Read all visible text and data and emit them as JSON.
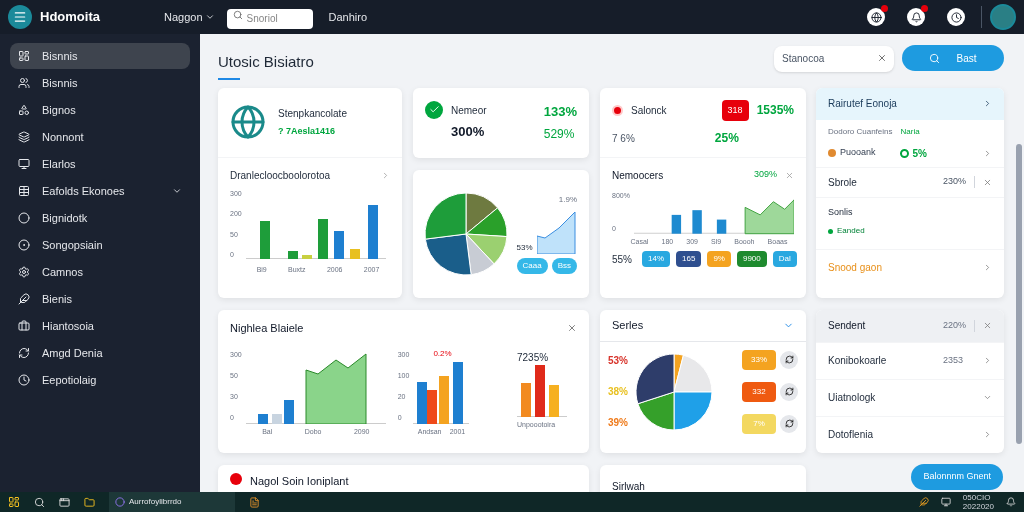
{
  "topbar": {
    "brand": "Hdomoita",
    "menu": "Naggon",
    "search": {
      "placeholder": "Snoriol"
    },
    "link": "Danhiro",
    "notifications": [
      {
        "badge": true
      },
      {
        "badge": true
      },
      {
        "badge": false
      }
    ]
  },
  "sidebar": {
    "items": [
      {
        "label": "Bisnnis",
        "selected": true
      },
      {
        "label": "Bisnnis",
        "selected": false
      },
      {
        "label": "Bignos",
        "selected": false
      },
      {
        "label": "Nonnont",
        "selected": false
      },
      {
        "label": "Elarlos",
        "selected": false
      },
      {
        "label": "Eafolds Ekonoes",
        "selected": false,
        "expanded": false
      },
      {
        "label": "Bignidotk",
        "selected": false
      },
      {
        "label": "Songopsiain",
        "selected": false
      },
      {
        "label": "Camnos",
        "selected": false
      },
      {
        "label": "Bienis",
        "selected": false
      },
      {
        "label": "Hiantosoia",
        "selected": false
      },
      {
        "label": "Amgd Denia",
        "selected": false
      },
      {
        "label": "Eepotiolaig",
        "selected": false
      }
    ]
  },
  "page": {
    "title": "Utosic Bisiatro",
    "filter": {
      "value": "Stanocoa"
    },
    "action": "Bast"
  },
  "globe_card": {
    "title": "Stenpkancolate",
    "subtitle": "? 7Aesla1416",
    "chart_title": "Dranlecloocboolorotoa",
    "y_ticks": [
      "300",
      "200",
      "50",
      "0"
    ],
    "x_labels": [
      "Bi9",
      "Buxtz",
      "2006",
      "2007"
    ]
  },
  "status_card": {
    "title": "Nemeor",
    "value": "300%",
    "change": "133%",
    "change_2": "529%"
  },
  "pie_card": {
    "corner": "1.9%",
    "reading": "53%",
    "tags": [
      "Caaa",
      "Bss"
    ]
  },
  "sales_card": {
    "title": "Salonck",
    "badge": "318",
    "value": "1535%",
    "change": "7 6%",
    "change_2": "25%",
    "chart_title": "Nemoocers",
    "chart_value": "309%",
    "y_ticks": [
      "800%",
      "0"
    ],
    "x_labels": [
      "Casal",
      "180",
      "309",
      "Sl9",
      "Boooh",
      "Boaas"
    ],
    "share": "55%",
    "tags": [
      {
        "label": "14%",
        "color": "#29a8e0"
      },
      {
        "label": "165",
        "color": "#2f4f8f"
      },
      {
        "label": "9%",
        "color": "#f4a320"
      },
      {
        "label": "9900",
        "color": "#1e8a2e"
      },
      {
        "label": "Dal",
        "color": "#29a8e0"
      }
    ]
  },
  "trend_card": {
    "title": "Nighlea Blaiele",
    "y_ticks": [
      "300",
      "50",
      "30",
      "0"
    ],
    "x_labels": [
      "Bal",
      "Dobo",
      "2090"
    ],
    "y_ticks_2": [
      "300",
      "100",
      "20",
      "0"
    ],
    "x_labels_2": [
      "Andsan",
      "2001"
    ],
    "marker": "0.2%",
    "reading": "7235%",
    "reading_label": "Unpoootoira"
  },
  "series_card": {
    "title": "Serles",
    "shares": [
      {
        "label": "53%",
        "color": "#d8332a"
      },
      {
        "label": "38%",
        "color": "#e8c020"
      },
      {
        "label": "39%",
        "color": "#ef7a1a"
      }
    ],
    "tags": [
      {
        "label": "33%",
        "color": "#f4a320"
      },
      {
        "label": "332",
        "color": "#ef5a10"
      },
      {
        "label": "7%",
        "color": "#f3d860"
      }
    ]
  },
  "bottom_cards": [
    {
      "title": "Nagol Soin Ioniplant"
    },
    {
      "title": "Sirlwah"
    }
  ],
  "report_panel": {
    "title": "Rairutef Eonoja",
    "caption": "Dodoro Cuanfeins",
    "caption_status": "Naria",
    "item": "Puooank",
    "item_value": "5%",
    "row": "Sbrole",
    "row_value": "230%",
    "section": "Sonlis",
    "section_item": "Eanded",
    "link": "Snood gaon"
  },
  "list_panel": {
    "title": "Sendent",
    "title_value": "220%",
    "rows": [
      {
        "label": "Konibokoarle",
        "value": "2353",
        "expanded": false
      },
      {
        "label": "Uiatnologk",
        "expanded": true
      },
      {
        "label": "Dotoflenia",
        "expanded": false
      }
    ]
  },
  "float_button": "Balonnnm Gnent",
  "taskbar": {
    "app": "Aurrofoylibrrdo",
    "time": "050CIO",
    "date": "2022020"
  }
}
